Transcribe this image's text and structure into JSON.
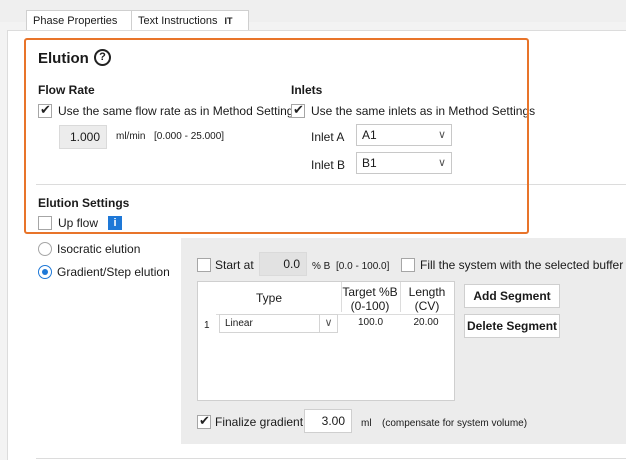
{
  "tabs": [
    {
      "label": "Phase Properties",
      "active": true
    },
    {
      "label": "Text Instructions",
      "badge": "IT"
    }
  ],
  "elution": {
    "title": "Elution",
    "help_icon": "help-circle-icon",
    "flow_rate": {
      "heading": "Flow Rate",
      "same_checkbox_label": "Use the same flow rate as in Method Settings",
      "checked": true,
      "value": "1.000",
      "unit": "ml/min",
      "range": "[0.000 - 25.000]"
    },
    "inlets": {
      "heading": "Inlets",
      "same_checkbox_label": "Use the same inlets as in Method Settings",
      "checked": true,
      "inlet_a_label": "Inlet A",
      "inlet_a_value": "A1",
      "inlet_b_label": "Inlet B",
      "inlet_b_value": "B1"
    },
    "settings": {
      "heading": "Elution Settings",
      "up_flow_label": "Up flow",
      "up_flow_checked": false,
      "info_icon": "info-icon"
    }
  },
  "elution_mode": {
    "isocratic_label": "Isocratic elution",
    "gradient_label": "Gradient/Step elution",
    "selected": "gradient"
  },
  "gradient": {
    "start_at_label": "Start at",
    "start_at_value": "0.0",
    "start_at_unit": "% B",
    "start_at_range": "[0.0 - 100.0]",
    "fill_label": "Fill the system with the selected buffer",
    "table": {
      "headers": {
        "type": "Type",
        "target": "Target %B (0-100)",
        "length": "Length (CV)"
      },
      "rows": [
        {
          "index": "1",
          "type": "Linear",
          "target": "100.0",
          "length": "20.00"
        }
      ]
    },
    "add_segment_label": "Add Segment",
    "delete_segment_label": "Delete Segment",
    "finalize_label": "Finalize gradient",
    "finalize_checked": true,
    "finalize_value": "3.00",
    "finalize_unit": "ml",
    "finalize_note": "(compensate for system volume)"
  },
  "colors": {
    "highlight": "#e8742a",
    "accent": "#1e78d7"
  }
}
